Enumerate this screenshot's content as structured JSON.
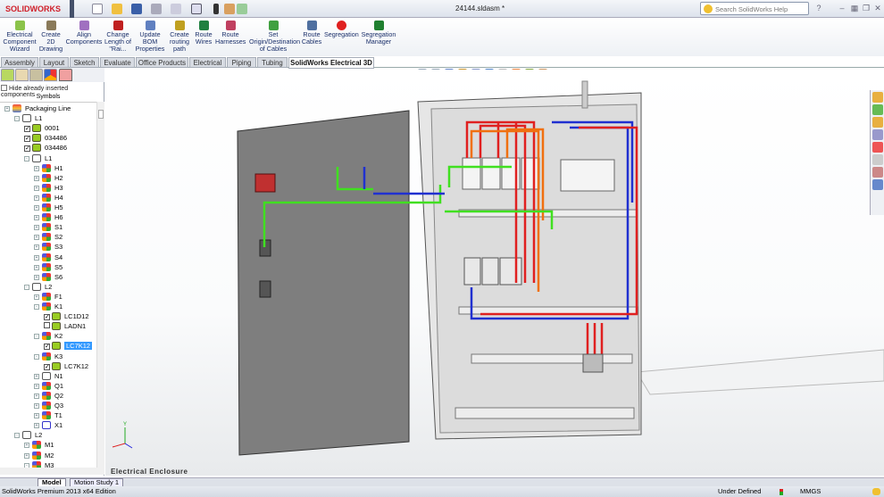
{
  "app": {
    "brand": "SOLIDWORKS",
    "document_title": "24144.sldasm *",
    "search_placeholder": "Search SolidWorks Help"
  },
  "ribbon": [
    {
      "label": "Electrical Component Wizard",
      "icon": "wizard-icon",
      "color": "#8bc34a"
    },
    {
      "label": "Create 2D Drawing",
      "icon": "drawing-icon",
      "color": "#8a7a5a"
    },
    {
      "label": "Align Components",
      "icon": "align-icon",
      "color": "#a070c0"
    },
    {
      "label": "Change Length of \"Rai...",
      "icon": "rail-length-icon",
      "color": "#c02020"
    },
    {
      "label": "Update BOM Properties",
      "icon": "bom-icon",
      "color": "#6080c0"
    },
    {
      "label": "Create routing path",
      "icon": "routing-path-icon",
      "color": "#c0a020"
    },
    {
      "label": "Route Wires",
      "icon": "route-wires-icon",
      "color": "#208040"
    },
    {
      "label": "Route Harnesses",
      "icon": "route-harnesses-icon",
      "color": "#c04060"
    },
    {
      "label": "Set Origin/Destination of Cables",
      "icon": "cable-origin-icon",
      "color": "#40a040"
    },
    {
      "label": "Route Cables",
      "icon": "route-cables-icon",
      "color": "#5070a0"
    },
    {
      "label": "Segregation",
      "icon": "segregation-icon",
      "color": "#e02020"
    },
    {
      "label": "Segregation Manager",
      "icon": "segregation-manager-icon",
      "color": "#208030"
    }
  ],
  "tabs": [
    {
      "label": "Assembly"
    },
    {
      "label": "Layout"
    },
    {
      "label": "Sketch"
    },
    {
      "label": "Evaluate"
    },
    {
      "label": "Office Products"
    },
    {
      "label": "Electrical"
    },
    {
      "label": "Piping"
    },
    {
      "label": "Tubing"
    },
    {
      "label": "SolidWorks Electrical 3D",
      "active": true
    }
  ],
  "panel": {
    "hide_label": "Hide already inserted components",
    "section": "Symbols"
  },
  "tree": [
    {
      "label": "Packaging Line",
      "level": 0,
      "icon": "pkg",
      "exp": "+"
    },
    {
      "label": "L1",
      "level": 1,
      "icon": "box",
      "exp": "-"
    },
    {
      "label": "0001",
      "level": 2,
      "icon": "part",
      "check": true
    },
    {
      "label": "034486",
      "level": 2,
      "icon": "part",
      "check": true
    },
    {
      "label": "034486",
      "level": 2,
      "icon": "part",
      "check": true
    },
    {
      "label": "L1",
      "level": 2,
      "icon": "box",
      "exp": "-"
    },
    {
      "label": "H1",
      "level": 3,
      "icon": "comp",
      "exp": "+"
    },
    {
      "label": "H2",
      "level": 3,
      "icon": "comp",
      "exp": "+"
    },
    {
      "label": "H3",
      "level": 3,
      "icon": "comp",
      "exp": "+"
    },
    {
      "label": "H4",
      "level": 3,
      "icon": "comp",
      "exp": "+"
    },
    {
      "label": "H5",
      "level": 3,
      "icon": "comp",
      "exp": "+"
    },
    {
      "label": "H6",
      "level": 3,
      "icon": "comp",
      "exp": "+"
    },
    {
      "label": "S1",
      "level": 3,
      "icon": "comp",
      "exp": "+"
    },
    {
      "label": "S2",
      "level": 3,
      "icon": "comp",
      "exp": "+"
    },
    {
      "label": "S3",
      "level": 3,
      "icon": "comp",
      "exp": "+"
    },
    {
      "label": "S4",
      "level": 3,
      "icon": "comp",
      "exp": "+"
    },
    {
      "label": "S5",
      "level": 3,
      "icon": "comp",
      "exp": "+"
    },
    {
      "label": "S6",
      "level": 3,
      "icon": "comp",
      "exp": "+"
    },
    {
      "label": "L2",
      "level": 2,
      "icon": "box",
      "exp": "-"
    },
    {
      "label": "F1",
      "level": 3,
      "icon": "comp",
      "exp": "+"
    },
    {
      "label": "K1",
      "level": 3,
      "icon": "comp",
      "exp": "-"
    },
    {
      "label": "LC1D12",
      "level": 4,
      "icon": "part",
      "check": true
    },
    {
      "label": "LADN1",
      "level": 4,
      "icon": "part",
      "check": false
    },
    {
      "label": "K2",
      "level": 3,
      "icon": "comp",
      "exp": "-"
    },
    {
      "label": "LC7K12",
      "level": 4,
      "icon": "part",
      "check": true,
      "selected": true
    },
    {
      "label": "K3",
      "level": 3,
      "icon": "comp",
      "exp": "-"
    },
    {
      "label": "LC7K12",
      "level": 4,
      "icon": "part",
      "check": true
    },
    {
      "label": "N1",
      "level": 3,
      "icon": "box",
      "exp": "+"
    },
    {
      "label": "Q1",
      "level": 3,
      "icon": "comp",
      "exp": "+"
    },
    {
      "label": "Q2",
      "level": 3,
      "icon": "comp",
      "exp": "+"
    },
    {
      "label": "Q3",
      "level": 3,
      "icon": "comp",
      "exp": "+"
    },
    {
      "label": "T1",
      "level": 3,
      "icon": "comp",
      "exp": "+"
    },
    {
      "label": "X1",
      "level": 3,
      "icon": "term",
      "exp": "+"
    },
    {
      "label": "L2",
      "level": 1,
      "icon": "box",
      "exp": "-"
    },
    {
      "label": "M1",
      "level": 2,
      "icon": "comp",
      "exp": "+"
    },
    {
      "label": "M2",
      "level": 2,
      "icon": "comp",
      "exp": "+"
    },
    {
      "label": "M3",
      "level": 2,
      "icon": "comp",
      "exp": "-"
    }
  ],
  "viewport": {
    "label": "Electrical Enclosure",
    "triad": {
      "x": "X",
      "y": "Y",
      "z": "Z"
    }
  },
  "bottom_tabs": [
    {
      "label": "Model",
      "active": true
    },
    {
      "label": "Motion Study 1"
    }
  ],
  "status": {
    "edition": "SolidWorks Premium 2013 x64 Edition",
    "state": "Under Defined",
    "units": "MMGS"
  }
}
